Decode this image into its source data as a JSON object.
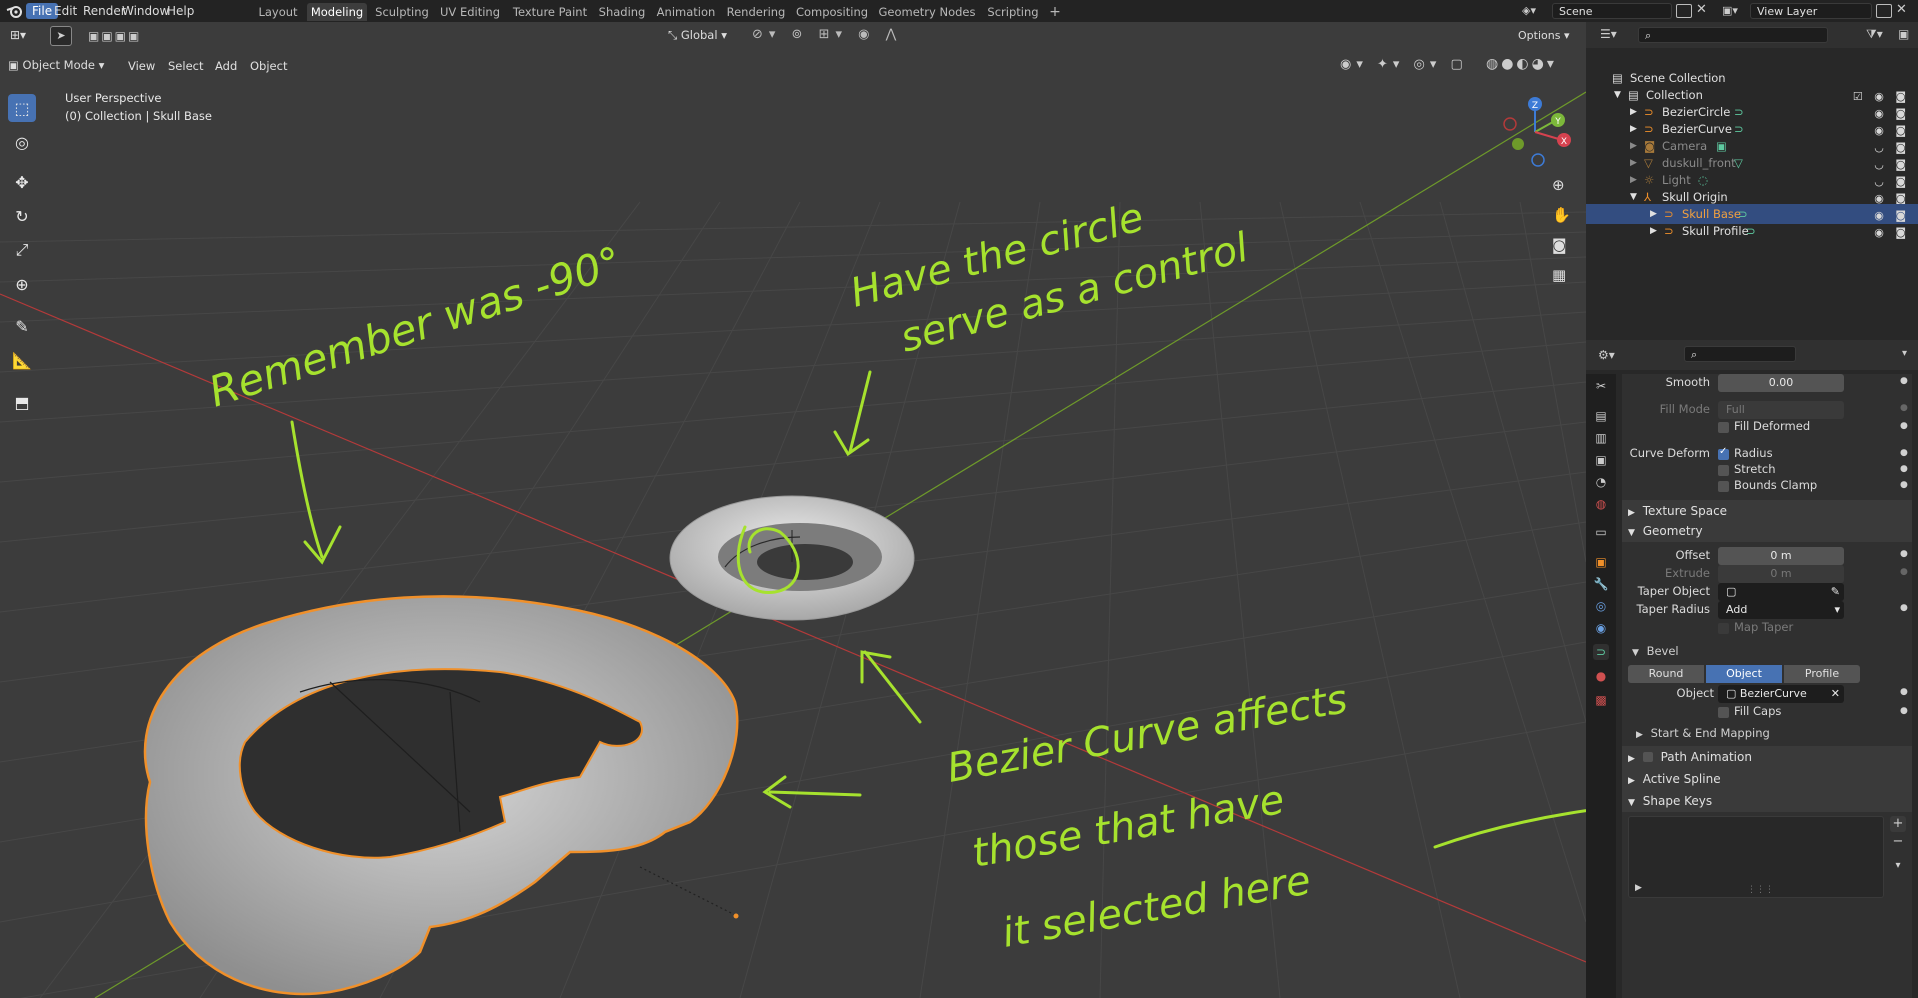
{
  "topbar": {
    "menus": [
      "File",
      "Edit",
      "Render",
      "Window",
      "Help"
    ],
    "workspaces": [
      "Layout",
      "Modeling",
      "Sculpting",
      "UV Editing",
      "Texture Paint",
      "Shading",
      "Animation",
      "Rendering",
      "Compositing",
      "Geometry Nodes",
      "Scripting"
    ],
    "active_workspace": "Modeling",
    "add_tab": "+",
    "scene_name": "Scene",
    "view_layer": "View Layer"
  },
  "viewport": {
    "mode": "Object Mode",
    "menus": [
      "View",
      "Select",
      "Add",
      "Object"
    ],
    "transform_orientation": "Global",
    "options_label": "Options",
    "overlay_line1": "User Perspective",
    "overlay_line2": "(0) Collection | Skull Base",
    "gizmo_axes": {
      "z": "Z",
      "y": "Y",
      "x": "X"
    }
  },
  "annotations": {
    "note1": "Remember was -90°",
    "note2_line1": "Have the circle",
    "note2_line2": "serve as a control",
    "note3_line1": "Bezier Curve affects",
    "note3_line2": "those that have",
    "note3_line3": "it selected here"
  },
  "outliner": {
    "root": "Scene Collection",
    "collection": "Collection",
    "items": [
      {
        "name": "BezierCircle",
        "hidden": false,
        "selected": false
      },
      {
        "name": "BezierCurve",
        "hidden": false,
        "selected": false
      },
      {
        "name": "Camera",
        "hidden": true,
        "selected": false
      },
      {
        "name": "duskull_front",
        "hidden": true,
        "selected": false
      },
      {
        "name": "Light",
        "hidden": true,
        "selected": false
      },
      {
        "name": "Skull Origin",
        "hidden": false,
        "selected": false
      },
      {
        "name": "Skull Base",
        "hidden": false,
        "selected": true
      },
      {
        "name": "Skull Profile",
        "hidden": false,
        "selected": false
      }
    ]
  },
  "properties": {
    "smooth_label": "Smooth",
    "smooth_value": "0.00",
    "fill_mode_label": "Fill Mode",
    "fill_mode_value": "Full",
    "fill_deformed": "Fill Deformed",
    "curve_deform_label": "Curve Deform",
    "radius": "Radius",
    "stretch": "Stretch",
    "bounds_clamp": "Bounds Clamp",
    "texture_space": "Texture Space",
    "geometry": "Geometry",
    "offset_label": "Offset",
    "offset_value": "0 m",
    "extrude_label": "Extrude",
    "extrude_value": "0 m",
    "taper_object_label": "Taper Object",
    "taper_radius_label": "Taper Radius",
    "taper_radius_value": "Add",
    "map_taper": "Map Taper",
    "bevel": "Bevel",
    "bevel_modes": [
      "Round",
      "Object",
      "Profile"
    ],
    "bevel_active": "Object",
    "object_label": "Object",
    "object_value": "BezierCurve",
    "fill_caps": "Fill Caps",
    "start_end_mapping": "Start & End Mapping",
    "path_animation": "Path Animation",
    "active_spline": "Active Spline",
    "shape_keys": "Shape Keys"
  },
  "colors": {
    "accent": "#4772b3",
    "annotation": "#a6e22e",
    "selection_outline": "#f0902a",
    "panel_bg": "#282828"
  }
}
